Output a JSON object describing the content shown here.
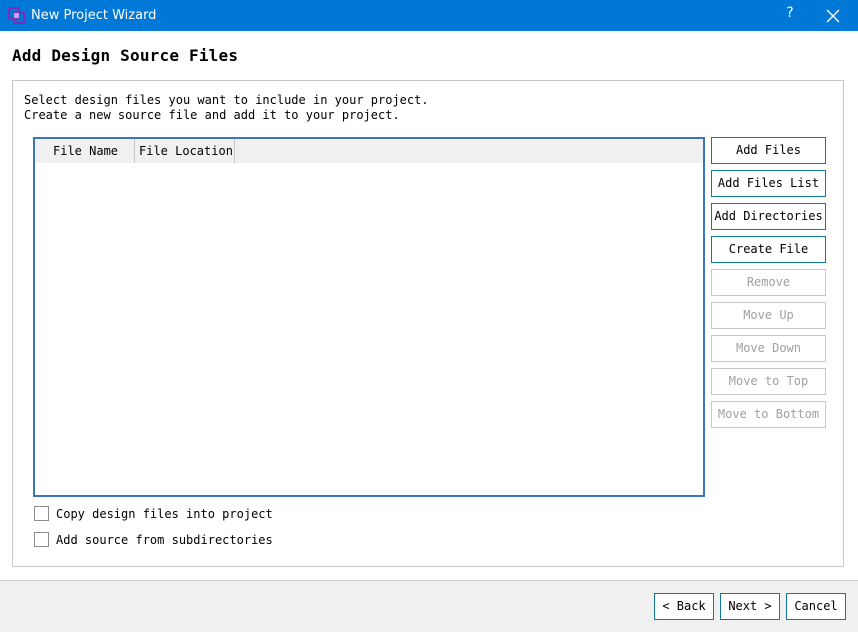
{
  "window": {
    "title": "New Project Wizard",
    "help_label": "?",
    "accent_color": "#0078d7"
  },
  "page": {
    "title": "Add Design Source Files",
    "description_line1": "Select design files you want to include in your project.",
    "description_line2": "Create a new source file and add it to your project."
  },
  "table": {
    "columns": [
      "File Name",
      "File Location"
    ],
    "rows": []
  },
  "side_buttons": {
    "add_files": "Add Files",
    "add_files_list": "Add Files List",
    "add_directories": "Add Directories",
    "create_file": "Create File",
    "remove": "Remove",
    "move_up": "Move Up",
    "move_down": "Move Down",
    "move_to_top": "Move to Top",
    "move_to_bottom": "Move to Bottom"
  },
  "options": {
    "copy_files": {
      "label": "Copy design files into project",
      "checked": false
    },
    "add_subdirs": {
      "label": "Add source from subdirectories",
      "checked": false
    }
  },
  "footer": {
    "back": "< Back",
    "next": "Next >",
    "cancel": "Cancel"
  },
  "icons": {
    "app": "vivado-logo-icon",
    "close": "close-icon"
  }
}
